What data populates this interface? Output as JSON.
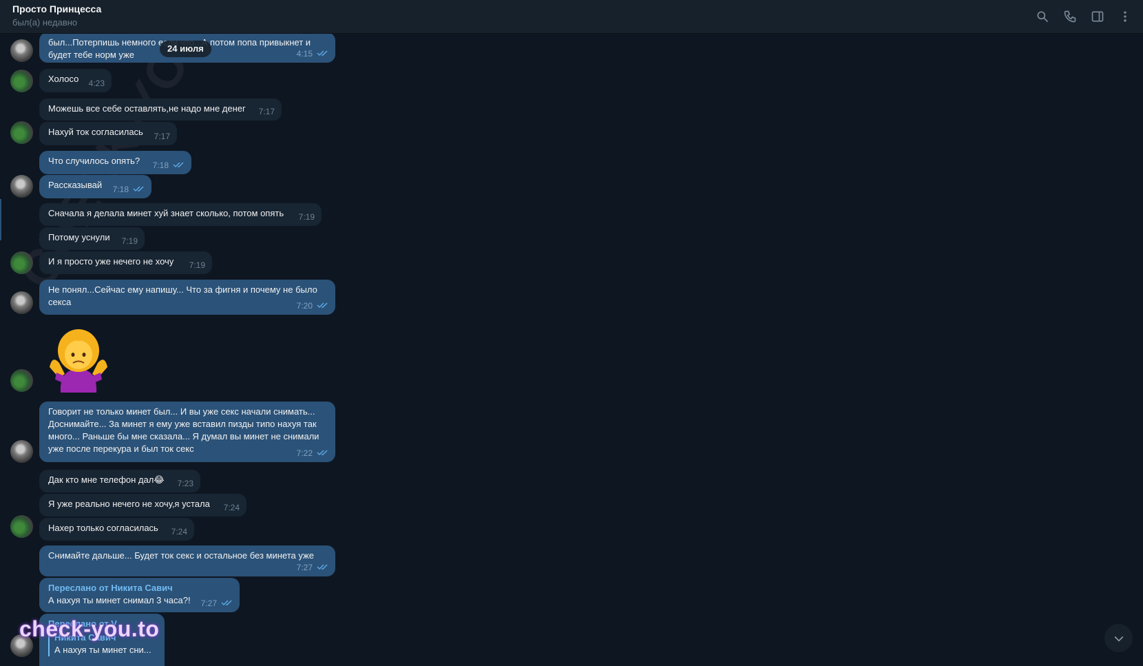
{
  "header": {
    "title": "Просто Принцесса",
    "status": "был(а) недавно",
    "icons": [
      "search-icon",
      "phone-icon",
      "sidebar-icon",
      "more-icon"
    ]
  },
  "date_separator": "24 июля",
  "messages": [
    {
      "id": "m0",
      "dir": "out",
      "text": "был...Потерпишь немного если что...А потом попа привыкнет и будет тебе норм уже",
      "time": "4:15",
      "read": true
    },
    {
      "id": "m1",
      "dir": "in",
      "text": "Холосо",
      "time": "4:23"
    },
    {
      "id": "m2",
      "dir": "in",
      "text": "Можешь все себе оставлять,не надо мне денег",
      "time": "7:17"
    },
    {
      "id": "m3",
      "dir": "in",
      "text": "Нахуй ток согласилась",
      "time": "7:17"
    },
    {
      "id": "m4",
      "dir": "out",
      "text": "Что случилось опять?",
      "time": "7:18",
      "read": true
    },
    {
      "id": "m5",
      "dir": "out",
      "text": "Рассказывай",
      "time": "7:18",
      "read": true
    },
    {
      "id": "m6",
      "dir": "in",
      "text": "Сначала я делала минет хуй знает сколько, потом опять",
      "time": "7:19"
    },
    {
      "id": "m7",
      "dir": "in",
      "text": "Потому уснули",
      "time": "7:19"
    },
    {
      "id": "m8",
      "dir": "in",
      "text": "И я просто уже нечего не хочу",
      "time": "7:19"
    },
    {
      "id": "m9",
      "dir": "out",
      "text": "Не понял...Сейчас ему напишу... Что за фигня и почему не было секса",
      "time": "7:20",
      "read": true
    },
    {
      "id": "m10",
      "dir": "in",
      "type": "emoji",
      "emoji_name": "person-shrugging-emoji"
    },
    {
      "id": "m11",
      "dir": "out",
      "text": "Говорит не только минет был... И вы уже секс начали снимать... Доснимайте... За минет я ему уже вставил пизды типо нахуя так много... Раньше бы мне сказала... Я думал вы минет не снимали уже после перекура и был ток секс",
      "time": "7:22",
      "read": true
    },
    {
      "id": "m12",
      "dir": "in",
      "text": "Дак кто мне телефон дал😂",
      "time": "7:23"
    },
    {
      "id": "m13",
      "dir": "in",
      "text": "Я уже реально нечего не хочу,я устала",
      "time": "7:24"
    },
    {
      "id": "m14",
      "dir": "in",
      "text": "Нахер только согласилась",
      "time": "7:24"
    },
    {
      "id": "m15",
      "dir": "out",
      "text": "Снимайте дальше... Будет ток секс и остальное без минета уже",
      "time": "7:27",
      "read": true
    },
    {
      "id": "m16",
      "dir": "out",
      "forwarded_from": "Переслано от Никита Савич",
      "text": "А нахуя ты минет снимал 3 часа?!",
      "time": "7:27",
      "read": true
    },
    {
      "id": "m17",
      "dir": "out",
      "forwarded_from": "Переслано от V",
      "quote_author": "Никита Савич",
      "text": "А нахуя ты минет сни..."
    }
  ],
  "watermark": "check-you.to",
  "diagonal_watermark": "CHECK-YOU.ME",
  "colors": {
    "background": "#0e1621",
    "header": "#17212b",
    "incoming": "#182533",
    "outgoing": "#2b5278",
    "link": "#71baf2"
  }
}
